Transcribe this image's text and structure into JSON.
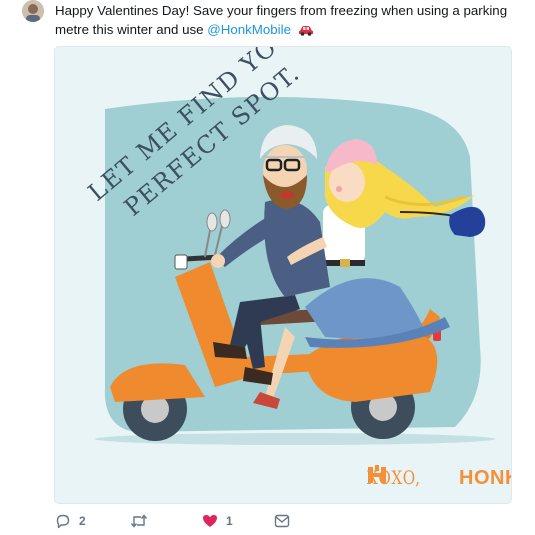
{
  "tweet": {
    "text_main": "Happy Valentines Day! Save your fingers from freezing when using a parking metre this winter and use ",
    "mention": "@HonkMobile",
    "emoji_icon": "car-icon"
  },
  "illustration": {
    "headline_line1": "LET ME FIND YOUR",
    "headline_line2": "PERFECT SPOT.",
    "brand_xoxo": "XOXO,",
    "brand_name": "HONK",
    "colors": {
      "background": "#9fcfd3",
      "scooter": "#f08a2e",
      "headline": "#3d4f60",
      "brand": "#f2913a",
      "skirt": "#6f96c9",
      "hair": "#f7d84a"
    }
  },
  "actions": {
    "reply_count": "2",
    "retweet_count": "",
    "like_count": "1",
    "reply_icon": "reply-icon",
    "retweet_icon": "retweet-icon",
    "like_icon": "heart-icon",
    "dm_icon": "envelope-icon",
    "like_color": "#e0245e"
  }
}
